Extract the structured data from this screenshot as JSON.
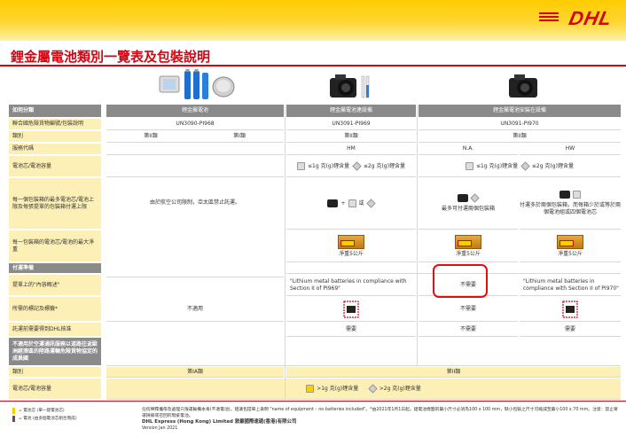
{
  "brand": {
    "logo_text": "DHL",
    "red": "#d40511",
    "yellow": "#ffcc00"
  },
  "title": "鋰金屬電池類別一覽表及包裝說明",
  "columns": {
    "c1": "鋰金屬電池",
    "c2": "鋰金屬電池連設備",
    "c3": "鋰金屬電池安裝在設備"
  },
  "rows": {
    "r_class": "如何分類",
    "r_un": "聯合國危險貨物編號/包裝說明",
    "un_c1": "UN3090-PI968",
    "un_c2": "UN3091-PI969",
    "un_c3": "UN3091-PI970",
    "r_category": "類別",
    "cat_c1a": "第II類",
    "cat_c1b": "第I類",
    "cat_c2": "第II類",
    "cat_c3": "第II類",
    "r_service": "服務代碼",
    "svc_c2": "HM",
    "svc_c3a": "N.A.",
    "svc_c3b": "HW",
    "r_capacity": "電池芯/電池容量",
    "cap_small": "≤1g 克(g)鋰含量",
    "cap_large": "≤2g 克(g)鋰含量",
    "r_max_per_pkg": "每一個包裝箱的最多電池芯/電池上限及每張提單的包裝箱付運上限",
    "mp_c1": "由於航空公司限制，亞太區禁止託運。",
    "mp_plus": "+",
    "mp_or": "或",
    "mp_c3a": "最多可付運兩個包裝箱",
    "mp_c3b": "付運多於兩個包裝箱，而每箱少於或等於兩個電池組或四個電池芯",
    "r_net": "每一包裝箱的電池芯/電池的最大淨重",
    "net_c2": "淨重5公斤",
    "net_c3a": "淨重5公斤",
    "net_c3b": "淨重5公斤",
    "r_req": "付運準備",
    "r_desc": "提單上的\"內容概述\"",
    "desc_c2": "\"Lithium metal batteries in compliance with Section II of PI969\"",
    "desc_c3a": "不需要",
    "desc_c3b": "\"Lithium metal batteries in compliance with Section II of PI970\"",
    "r_marks": "所需的標記及標籤*",
    "marks_c1": "不適用",
    "marks_c3a": "不需要",
    "r_approval": "託運前需要得到DHL核准",
    "appr_c2": "需要",
    "appr_c3a": "不需要",
    "appr_c3b": "需要",
    "r_nonair": "不適用於空運通訊服務以道路往返歐洲經濟區的陸路運輸危險貨物協定的成員國",
    "r_category2": "類別",
    "cat2_c1": "第IA類",
    "cat2_c23": "第II類",
    "r_capacity2": "電池芯/電池容量",
    "cap2_small": ">1g 克(g)鋰含量",
    "cap2_large": ">2g 克(g)鋰含量"
  },
  "legend": {
    "cell": "= 電池芯 (單一鋰電池芯)",
    "battery": "= 電池 (由多個電池芯組合而成)"
  },
  "footnote": {
    "text": "任何稀釋攜帶及處理只限運輸備本身(不適電池)。建議包提單上表明 \"name of equipment – no batteries included\"。*由2021年1月1日起，鋰電池標籤的最小尺寸必須為100 x 100 mm，缺小包裝之尺寸可縮減至最小100 x 70 mm。注意：禁止寄運損毀或召回的瑕疵電池。",
    "org": "DHL Express (Hong Kong) Limited 敦豪國際速遞(香港)有限公司",
    "version": "Version Jan 2021"
  }
}
